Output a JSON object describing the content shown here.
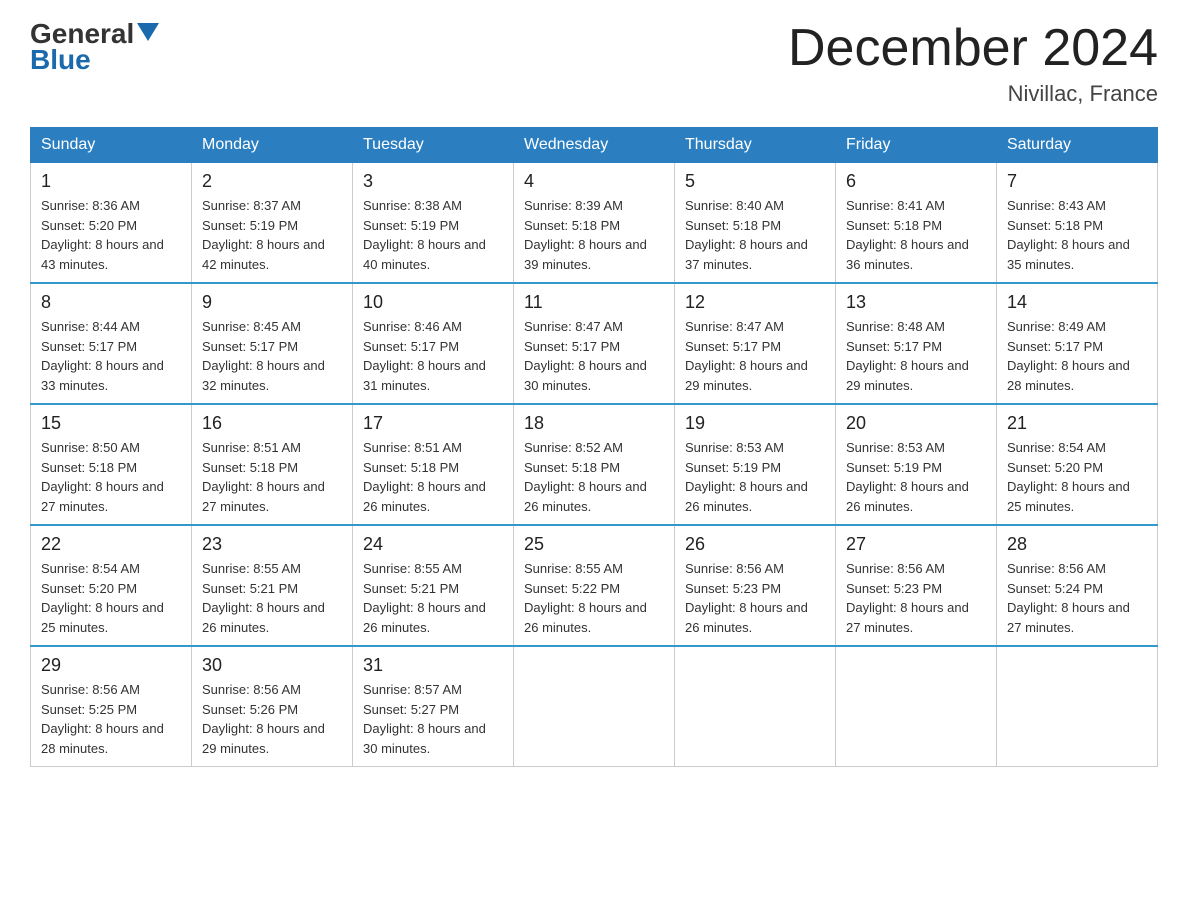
{
  "header": {
    "logo_line1": "General",
    "logo_line2": "Blue",
    "title": "December 2024",
    "subtitle": "Nivillac, France"
  },
  "days_of_week": [
    "Sunday",
    "Monday",
    "Tuesday",
    "Wednesday",
    "Thursday",
    "Friday",
    "Saturday"
  ],
  "weeks": [
    [
      {
        "day": "1",
        "sunrise": "8:36 AM",
        "sunset": "5:20 PM",
        "daylight": "8 hours and 43 minutes."
      },
      {
        "day": "2",
        "sunrise": "8:37 AM",
        "sunset": "5:19 PM",
        "daylight": "8 hours and 42 minutes."
      },
      {
        "day": "3",
        "sunrise": "8:38 AM",
        "sunset": "5:19 PM",
        "daylight": "8 hours and 40 minutes."
      },
      {
        "day": "4",
        "sunrise": "8:39 AM",
        "sunset": "5:18 PM",
        "daylight": "8 hours and 39 minutes."
      },
      {
        "day": "5",
        "sunrise": "8:40 AM",
        "sunset": "5:18 PM",
        "daylight": "8 hours and 37 minutes."
      },
      {
        "day": "6",
        "sunrise": "8:41 AM",
        "sunset": "5:18 PM",
        "daylight": "8 hours and 36 minutes."
      },
      {
        "day": "7",
        "sunrise": "8:43 AM",
        "sunset": "5:18 PM",
        "daylight": "8 hours and 35 minutes."
      }
    ],
    [
      {
        "day": "8",
        "sunrise": "8:44 AM",
        "sunset": "5:17 PM",
        "daylight": "8 hours and 33 minutes."
      },
      {
        "day": "9",
        "sunrise": "8:45 AM",
        "sunset": "5:17 PM",
        "daylight": "8 hours and 32 minutes."
      },
      {
        "day": "10",
        "sunrise": "8:46 AM",
        "sunset": "5:17 PM",
        "daylight": "8 hours and 31 minutes."
      },
      {
        "day": "11",
        "sunrise": "8:47 AM",
        "sunset": "5:17 PM",
        "daylight": "8 hours and 30 minutes."
      },
      {
        "day": "12",
        "sunrise": "8:47 AM",
        "sunset": "5:17 PM",
        "daylight": "8 hours and 29 minutes."
      },
      {
        "day": "13",
        "sunrise": "8:48 AM",
        "sunset": "5:17 PM",
        "daylight": "8 hours and 29 minutes."
      },
      {
        "day": "14",
        "sunrise": "8:49 AM",
        "sunset": "5:17 PM",
        "daylight": "8 hours and 28 minutes."
      }
    ],
    [
      {
        "day": "15",
        "sunrise": "8:50 AM",
        "sunset": "5:18 PM",
        "daylight": "8 hours and 27 minutes."
      },
      {
        "day": "16",
        "sunrise": "8:51 AM",
        "sunset": "5:18 PM",
        "daylight": "8 hours and 27 minutes."
      },
      {
        "day": "17",
        "sunrise": "8:51 AM",
        "sunset": "5:18 PM",
        "daylight": "8 hours and 26 minutes."
      },
      {
        "day": "18",
        "sunrise": "8:52 AM",
        "sunset": "5:18 PM",
        "daylight": "8 hours and 26 minutes."
      },
      {
        "day": "19",
        "sunrise": "8:53 AM",
        "sunset": "5:19 PM",
        "daylight": "8 hours and 26 minutes."
      },
      {
        "day": "20",
        "sunrise": "8:53 AM",
        "sunset": "5:19 PM",
        "daylight": "8 hours and 26 minutes."
      },
      {
        "day": "21",
        "sunrise": "8:54 AM",
        "sunset": "5:20 PM",
        "daylight": "8 hours and 25 minutes."
      }
    ],
    [
      {
        "day": "22",
        "sunrise": "8:54 AM",
        "sunset": "5:20 PM",
        "daylight": "8 hours and 25 minutes."
      },
      {
        "day": "23",
        "sunrise": "8:55 AM",
        "sunset": "5:21 PM",
        "daylight": "8 hours and 26 minutes."
      },
      {
        "day": "24",
        "sunrise": "8:55 AM",
        "sunset": "5:21 PM",
        "daylight": "8 hours and 26 minutes."
      },
      {
        "day": "25",
        "sunrise": "8:55 AM",
        "sunset": "5:22 PM",
        "daylight": "8 hours and 26 minutes."
      },
      {
        "day": "26",
        "sunrise": "8:56 AM",
        "sunset": "5:23 PM",
        "daylight": "8 hours and 26 minutes."
      },
      {
        "day": "27",
        "sunrise": "8:56 AM",
        "sunset": "5:23 PM",
        "daylight": "8 hours and 27 minutes."
      },
      {
        "day": "28",
        "sunrise": "8:56 AM",
        "sunset": "5:24 PM",
        "daylight": "8 hours and 27 minutes."
      }
    ],
    [
      {
        "day": "29",
        "sunrise": "8:56 AM",
        "sunset": "5:25 PM",
        "daylight": "8 hours and 28 minutes."
      },
      {
        "day": "30",
        "sunrise": "8:56 AM",
        "sunset": "5:26 PM",
        "daylight": "8 hours and 29 minutes."
      },
      {
        "day": "31",
        "sunrise": "8:57 AM",
        "sunset": "5:27 PM",
        "daylight": "8 hours and 30 minutes."
      },
      null,
      null,
      null,
      null
    ]
  ]
}
